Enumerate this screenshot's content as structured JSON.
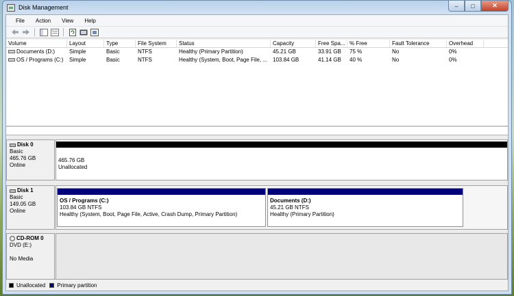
{
  "window": {
    "title": "Disk Management"
  },
  "caption": {
    "minimize": "–",
    "maximize": "□",
    "close": "✕"
  },
  "menu": [
    "File",
    "Action",
    "View",
    "Help"
  ],
  "volume_list": {
    "columns": [
      "Volume",
      "Layout",
      "Type",
      "File System",
      "Status",
      "Capacity",
      "Free Spa...",
      "% Free",
      "Fault Tolerance",
      "Overhead"
    ],
    "rows": [
      [
        "Documents (D:)",
        "Simple",
        "Basic",
        "NTFS",
        "Healthy (Primary Partition)",
        "45.21 GB",
        "33.91 GB",
        "75 %",
        "No",
        "0%"
      ],
      [
        "OS / Programs (C:)",
        "Simple",
        "Basic",
        "NTFS",
        "Healthy (System, Boot, Page File, ...",
        "103.84 GB",
        "41.14 GB",
        "40 %",
        "No",
        "0%"
      ]
    ]
  },
  "disks": {
    "disk0": {
      "name": "Disk 0",
      "type": "Basic",
      "size": "465.76 GB",
      "state": "Online",
      "unalloc_size": "465.76 GB",
      "unalloc_label": "Unallocated"
    },
    "disk1": {
      "name": "Disk 1",
      "type": "Basic",
      "size": "149.05 GB",
      "state": "Online",
      "p1": {
        "title": "OS / Programs  (C:)",
        "size": "103.84 GB NTFS",
        "status": "Healthy (System, Boot, Page File, Active, Crash Dump, Primary Partition)"
      },
      "p2": {
        "title": "Documents  (D:)",
        "size": "45.21 GB NTFS",
        "status": "Healthy (Primary Partition)"
      }
    },
    "cdrom0": {
      "name": "CD-ROM 0",
      "drive": "DVD (E:)",
      "media": "No Media"
    }
  },
  "legend": {
    "unallocated": "Unallocated",
    "primary": "Primary partition"
  },
  "colors": {
    "unallocated": "#000000",
    "primary": "#00007b"
  }
}
